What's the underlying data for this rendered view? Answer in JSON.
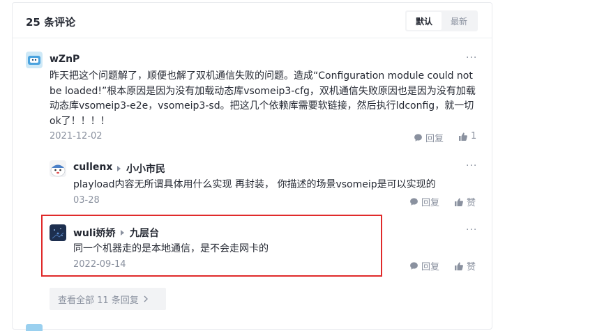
{
  "header": {
    "title": "25 条评论",
    "sort_default": "默认",
    "sort_newest": "最新"
  },
  "comment": {
    "author": "wZnP",
    "content": "昨天把这个问题解了，顺便也解了双机通信失败的问题。造成“Configuration module could not be loaded!”根本原因是因为没有加载动态库vsomeip3-cfg，双机通信失败原因也是因为没有加载动态库vsomeip3-e2e，vsomeip3-sd。把这几个依赖库需要软链接，然后执行ldconfig，就一切ok了！！！！",
    "date": "2021-12-02",
    "reply_label": "回复",
    "like_count": "1",
    "more": "···"
  },
  "replies": [
    {
      "author": "cullenx",
      "reply_to": "小小市民",
      "content": "playload内容无所谓具体用什么实现 再封装， 你描述的场景vsomeip是可以实现的",
      "date": "03-28",
      "reply_label": "回复",
      "like_label": "赞",
      "more": "···"
    },
    {
      "author": "wuli娇娇",
      "reply_to": "九层台",
      "content": "同一个机器走的是本地通信，是不会走网卡的",
      "date": "2022-09-14",
      "reply_label": "回复",
      "like_label": "赞",
      "more": "···"
    }
  ],
  "view_all": "查看全部 11 条回复",
  "colors": {
    "highlight_border": "#e02a2a",
    "muted_text": "#8a919f",
    "main_text": "#252933"
  }
}
